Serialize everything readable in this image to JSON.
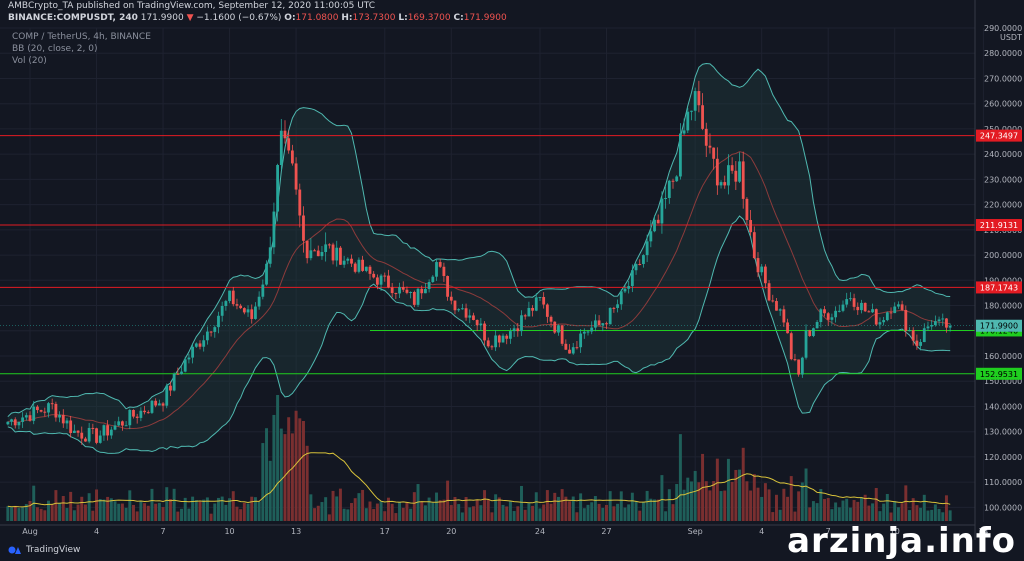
{
  "header": {
    "published": "AMBCrypto_TA published on TradingView.com, September 12, 2020 11:00:05 UTC",
    "symbol": "BINANCE:COMPUSDT, 240",
    "last": "171.9900",
    "change": "−1.1600 (−0.67%)",
    "o_label": "O:",
    "o": "171.0800",
    "h_label": "H:",
    "h": "173.7300",
    "l_label": "L:",
    "l": "169.3700",
    "c_label": "C:",
    "c": "171.9900"
  },
  "legend": {
    "pair": "COMP / TetherUS, 4h, BINANCE",
    "bb": "BB (20, close, 2, 0)",
    "vol": "Vol (20)"
  },
  "footer": {
    "brand": "TradingView",
    "watermark": "arzinja.info"
  },
  "colors": {
    "background": "#131722",
    "up": "#26a69a",
    "down": "#ef5350",
    "resistance": "#e31b23",
    "support": "#1fce1f",
    "bb_band": "#4fb8b0",
    "bb_basis": "#8c3b3b",
    "vol_ma": "#d8c23a"
  },
  "chart_data": {
    "type": "candlestick",
    "currency": "USDT",
    "ylim": [
      95,
      290
    ],
    "y_ticks": [
      "100.0000",
      "110.0000",
      "120.0000",
      "130.0000",
      "140.0000",
      "150.0000",
      "160.0000",
      "170.0000",
      "180.0000",
      "190.0000",
      "200.0000",
      "210.0000",
      "220.0000",
      "230.0000",
      "240.0000",
      "250.0000",
      "260.0000",
      "270.0000",
      "280.0000",
      "290.0000"
    ],
    "x_ticks": [
      {
        "label": "Aug",
        "bar": 6
      },
      {
        "label": "4",
        "bar": 24
      },
      {
        "label": "7",
        "bar": 42
      },
      {
        "label": "10",
        "bar": 60
      },
      {
        "label": "13",
        "bar": 78
      },
      {
        "label": "17",
        "bar": 102
      },
      {
        "label": "20",
        "bar": 120
      },
      {
        "label": "24",
        "bar": 144
      },
      {
        "label": "27",
        "bar": 162
      },
      {
        "label": "Sep",
        "bar": 186
      },
      {
        "label": "4",
        "bar": 204
      },
      {
        "label": "7",
        "bar": 222
      },
      {
        "label": "10",
        "bar": 240
      },
      {
        "label": "14",
        "bar": 264
      }
    ],
    "horizontal_levels": [
      {
        "value": 247.3497,
        "label": "247.3497",
        "color": "#e31b23",
        "kind": "resistance"
      },
      {
        "value": 211.9131,
        "label": "211.9131",
        "color": "#e31b23",
        "kind": "resistance"
      },
      {
        "value": 187.1743,
        "label": "187.1743",
        "color": "#e31b23",
        "kind": "resistance"
      },
      {
        "value": 170.1246,
        "label": "170.1246",
        "color": "#1fce1f",
        "kind": "support",
        "start_bar": 98
      },
      {
        "value": 152.9531,
        "label": "152.9531",
        "color": "#1fce1f",
        "kind": "support"
      }
    ],
    "last_price": {
      "value": 171.99,
      "label": "171.9900"
    },
    "close_anchors": [
      [
        0,
        134
      ],
      [
        6,
        137
      ],
      [
        12,
        140
      ],
      [
        18,
        130
      ],
      [
        24,
        128
      ],
      [
        30,
        133
      ],
      [
        36,
        138
      ],
      [
        42,
        143
      ],
      [
        48,
        158
      ],
      [
        54,
        170
      ],
      [
        60,
        183
      ],
      [
        66,
        175
      ],
      [
        70,
        195
      ],
      [
        74,
        245
      ],
      [
        77,
        232
      ],
      [
        80,
        205
      ],
      [
        86,
        202
      ],
      [
        92,
        198
      ],
      [
        98,
        192
      ],
      [
        104,
        188
      ],
      [
        110,
        182
      ],
      [
        116,
        197
      ],
      [
        120,
        182
      ],
      [
        126,
        176
      ],
      [
        130,
        166
      ],
      [
        136,
        170
      ],
      [
        140,
        176
      ],
      [
        144,
        182
      ],
      [
        148,
        172
      ],
      [
        152,
        163
      ],
      [
        156,
        170
      ],
      [
        160,
        172
      ],
      [
        164,
        178
      ],
      [
        168,
        188
      ],
      [
        172,
        200
      ],
      [
        176,
        212
      ],
      [
        180,
        230
      ],
      [
        184,
        255
      ],
      [
        186,
        262
      ],
      [
        190,
        238
      ],
      [
        194,
        228
      ],
      [
        198,
        235
      ],
      [
        202,
        200
      ],
      [
        206,
        185
      ],
      [
        210,
        175
      ],
      [
        212,
        160
      ],
      [
        214,
        152
      ],
      [
        216,
        168
      ],
      [
        220,
        176
      ],
      [
        224,
        178
      ],
      [
        228,
        184
      ],
      [
        232,
        178
      ],
      [
        236,
        174
      ],
      [
        240,
        182
      ],
      [
        244,
        170
      ],
      [
        246,
        165
      ],
      [
        250,
        174
      ],
      [
        252,
        172
      ]
    ],
    "volume_ylim": [
      0,
      120
    ],
    "volume_note": "volume bars with 20-period moving average"
  }
}
